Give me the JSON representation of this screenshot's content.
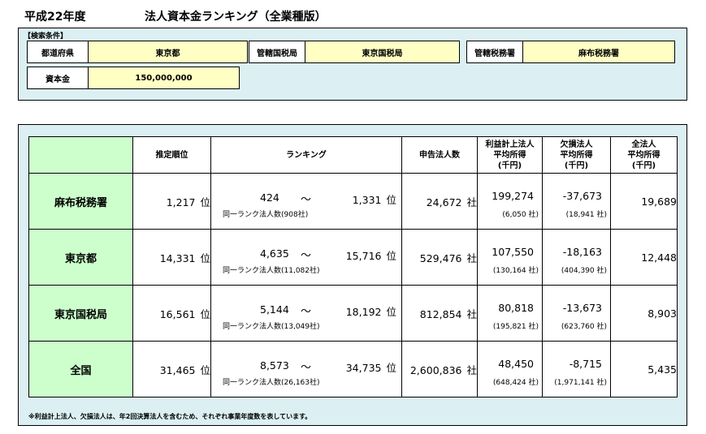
{
  "header": {
    "year": "平成22年度",
    "title": "法人資本金ランキング（全業種版）"
  },
  "search": {
    "heading": "【検索条件】",
    "prefecture": {
      "label": "都道府県",
      "value": "東京都"
    },
    "bureau": {
      "label": "管轄国税局",
      "value": "東京国税局"
    },
    "office": {
      "label": "管轄税務署",
      "value": "麻布税務署"
    },
    "capital": {
      "label": "資本金",
      "value": "150,000,000"
    }
  },
  "table": {
    "headers": {
      "estimated_rank": "推定順位",
      "ranking": "ランキング",
      "filing_count": "申告法人数",
      "profit_l1": "利益計上法人",
      "profit_l2": "平均所得",
      "profit_l3": "(千円)",
      "loss_l1": "欠損法人",
      "loss_l2": "平均所得",
      "loss_l3": "(千円)",
      "all_l1": "全法人",
      "all_l2": "平均所得",
      "all_l3": "(千円)"
    },
    "units": {
      "rank": "位",
      "company": "社",
      "tilde": "～"
    },
    "rows": [
      {
        "label": "麻布税務署",
        "rank": "1,217",
        "rank_low": "424",
        "rank_high": "1,331",
        "same_rank": "同一ランク法人数(908社)",
        "filings": "24,672",
        "profit_avg": "199,274",
        "profit_count": "(6,050 社)",
        "loss_avg": "-37,673",
        "loss_count": "(18,941 社)",
        "all_avg": "19,689"
      },
      {
        "label": "東京都",
        "rank": "14,331",
        "rank_low": "4,635",
        "rank_high": "15,716",
        "same_rank": "同一ランク法人数(11,082社)",
        "filings": "529,476",
        "profit_avg": "107,550",
        "profit_count": "(130,164 社)",
        "loss_avg": "-18,163",
        "loss_count": "(404,390 社)",
        "all_avg": "12,448"
      },
      {
        "label": "東京国税局",
        "rank": "16,561",
        "rank_low": "5,144",
        "rank_high": "18,192",
        "same_rank": "同一ランク法人数(13,049社)",
        "filings": "812,854",
        "profit_avg": "80,818",
        "profit_count": "(195,821 社)",
        "loss_avg": "-13,673",
        "loss_count": "(623,760 社)",
        "all_avg": "8,903"
      },
      {
        "label": "全国",
        "rank": "31,465",
        "rank_low": "8,573",
        "rank_high": "34,735",
        "same_rank": "同一ランク法人数(26,163社)",
        "filings": "2,600,836",
        "profit_avg": "48,450",
        "profit_count": "(648,424 社)",
        "loss_avg": "-8,715",
        "loss_count": "(1,971,141 社)",
        "all_avg": "5,435"
      }
    ],
    "footnote": "※利益計上法人、欠損法人は、年2回決算法人を含むため、それぞれ事業年度数を表しています。"
  },
  "colors": {
    "panel_bg": "#dcf0f3",
    "value_bg": "#ffffc4",
    "row_label_bg": "#ccffcc"
  }
}
